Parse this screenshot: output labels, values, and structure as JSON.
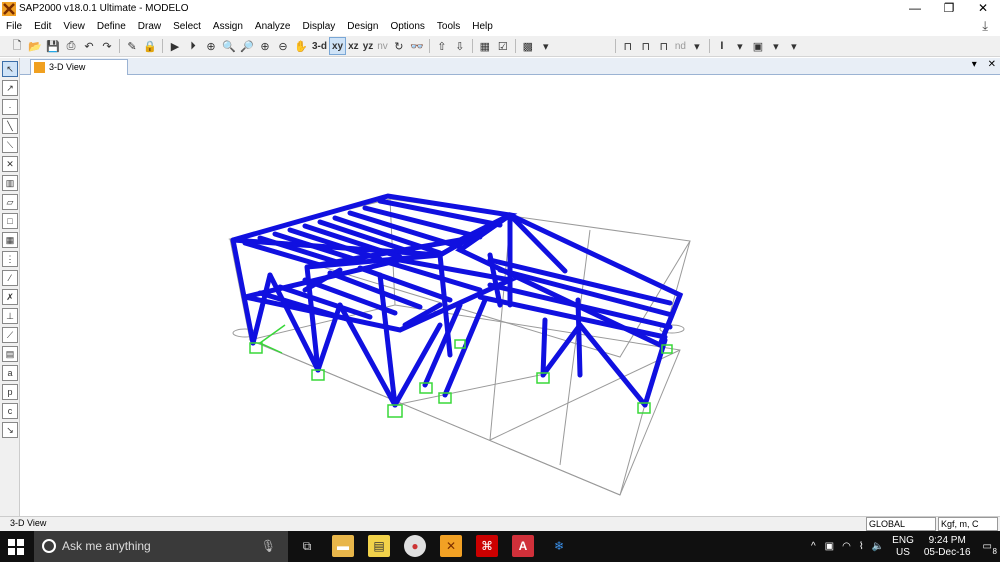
{
  "window": {
    "title": "SAP2000 v18.0.1 Ultimate  - MODELO",
    "controls": [
      "—",
      "❐",
      "✕"
    ]
  },
  "menu": [
    "File",
    "Edit",
    "View",
    "Define",
    "Draw",
    "Select",
    "Assign",
    "Analyze",
    "Display",
    "Design",
    "Options",
    "Tools",
    "Help"
  ],
  "toolbar": {
    "view3d": "3-d",
    "xy": "xy",
    "xz": "xz",
    "yz": "yz",
    "nv": "nv",
    "nd": "nd"
  },
  "tab": {
    "label": "3-D View"
  },
  "status": {
    "left": "3-D View",
    "coord_system": "GLOBAL",
    "units": "Kgf, m, C"
  },
  "taskbar": {
    "search_placeholder": "Ask me anything",
    "lang": "ENG",
    "region": "US",
    "time": "9:24 PM",
    "date": "05-Dec-16",
    "notif_count": "8"
  },
  "colors": {
    "frame": "#1010e0",
    "support": "#38d838",
    "grid": "#9a9a9a"
  }
}
